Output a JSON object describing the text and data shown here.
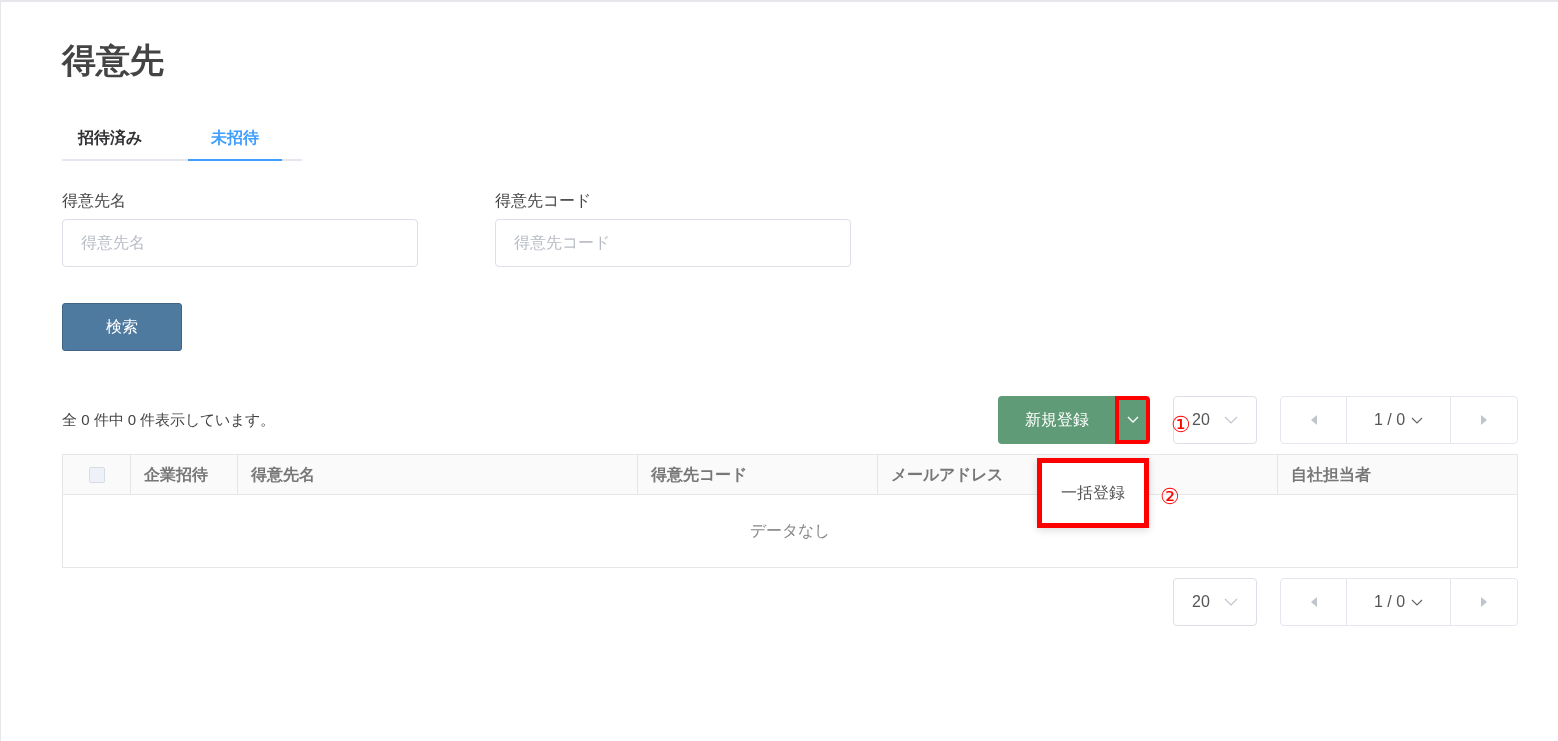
{
  "page_title": "得意先",
  "tabs": [
    {
      "label": "招待済み",
      "selected": false
    },
    {
      "label": "未招待",
      "selected": true
    }
  ],
  "filters": [
    {
      "label": "得意先名",
      "placeholder": "得意先名"
    },
    {
      "label": "得意先コード",
      "placeholder": "得意先コード"
    }
  ],
  "search_button": "検索",
  "result_count": "全 0 件中 0 件表示しています。",
  "new_button": {
    "label": "新規登録",
    "menu_open": true
  },
  "dropdown_menu": [
    "一括登録"
  ],
  "pagination_top": {
    "page_size": "20",
    "page": "1 / 0"
  },
  "table": {
    "select_all_checked": false,
    "columns": [
      "企業招待",
      "得意先名",
      "得意先コード",
      "メールアドレス",
      "自社担当者"
    ],
    "empty_text": "データなし"
  },
  "pagination_bottom": {
    "page_size": "20",
    "page": "1 / 0"
  },
  "annotations": [
    "①",
    "②"
  ]
}
